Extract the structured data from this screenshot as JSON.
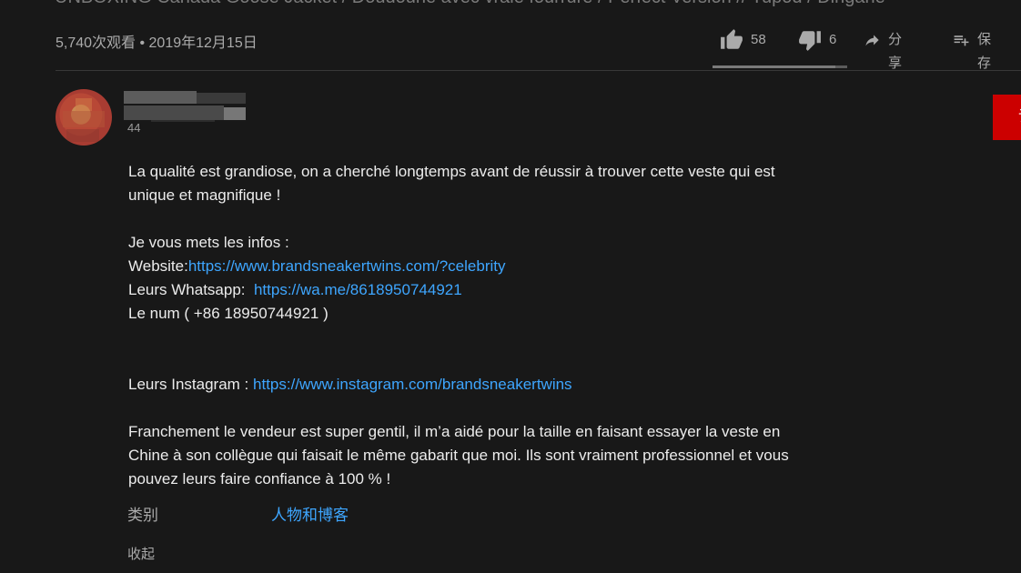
{
  "video": {
    "title_partial": "UNBOXING Canada Goose Jacket / Doudoune avec vraie fourrure / Perfect Version // Tupod / Dirigane",
    "views_date": "5,740次观看 • 2019年12月15日"
  },
  "actions": {
    "like_count": "58",
    "dislike_count": "6",
    "share_label": "分享",
    "save_label": "保存",
    "like_ratio": 0.91
  },
  "channel": {
    "subscriber_count": "44",
    "subscribe_label": "订"
  },
  "description": {
    "line1": "La qualité est grandiose, on a cherché longtemps avant de réussir à trouver cette veste qui est",
    "line2": "unique et magnifique !",
    "infos_heading": "Je vous mets les infos :",
    "website_prefix": "Website:",
    "website_url": "https://www.brandsneakertwins.com/?celebrity",
    "whatsapp_prefix": "Leurs Whatsapp:  ",
    "whatsapp_url": "https://wa.me/8618950744921",
    "phone_line": "Le num ( +86 18950744921 )",
    "instagram_prefix": "Leurs Instagram : ",
    "instagram_url": "https://www.instagram.com/brandsneakertwins",
    "para2_line1": "Franchement le vendeur est super gentil, il m’a aidé pour la taille en faisant essayer la veste en",
    "para2_line2": "Chine à son collègue qui faisait le même gabarit que moi. Ils sont vraiment professionnel et vous",
    "para2_line3": "pouvez leurs faire confiance à 100 % !"
  },
  "category": {
    "label": "类别",
    "value": "人物和博客"
  },
  "collapse_label": "收起",
  "colors": {
    "background": "#181818",
    "link": "#3ea6ff",
    "subscribe": "#cc0000"
  }
}
